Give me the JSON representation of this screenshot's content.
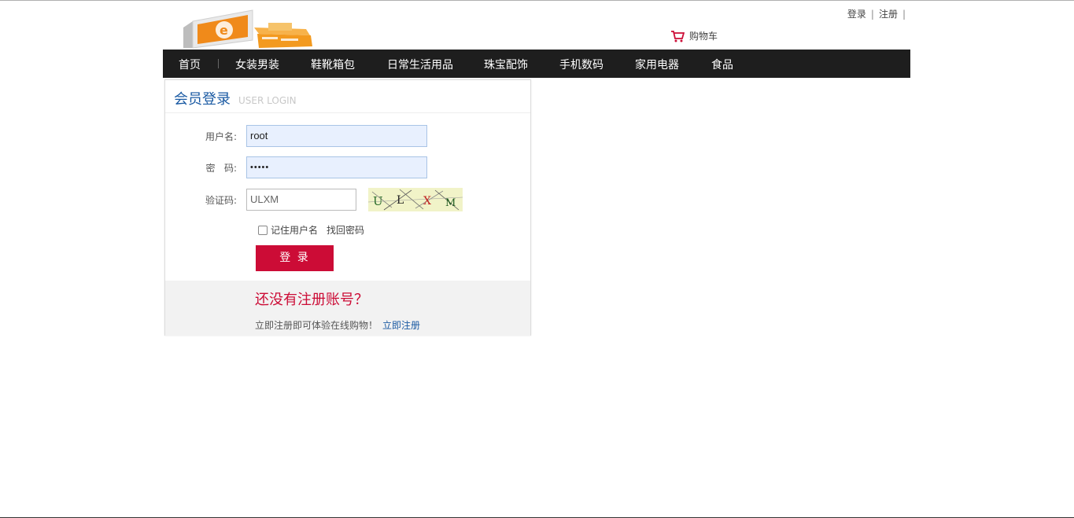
{
  "header": {
    "login_link": "登录",
    "register_link": "注册",
    "separator": "|",
    "cart_label": "购物车"
  },
  "nav": {
    "items": [
      "首页",
      "女装男装",
      "鞋靴箱包",
      "日常生活用品",
      "珠宝配饰",
      "手机数码",
      "家用电器",
      "食品"
    ]
  },
  "login": {
    "title": "会员登录",
    "subtitle": "USER LOGIN",
    "username_label": "用户名:",
    "username_value": "root",
    "password_label": "密   码:",
    "password_value": "•••••",
    "captcha_label": "验证码:",
    "captcha_value": "ULXM",
    "remember_label": "记住用户名",
    "forgot_label": "找回密码",
    "submit_label": "登 录"
  },
  "register": {
    "question": "还没有注册账号？",
    "text": "立即注册即可体验在线购物！",
    "link": "立即注册"
  },
  "colors": {
    "nav_bg": "#1e1e1e",
    "accent_red": "#cc0c36",
    "title_blue": "#1a5aa3"
  }
}
